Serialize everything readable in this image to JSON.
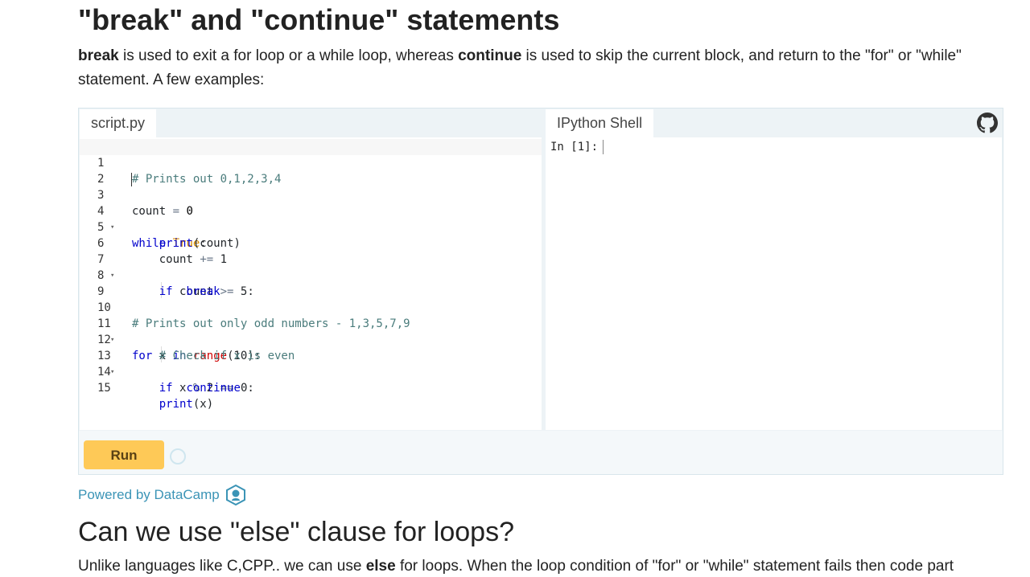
{
  "section1": {
    "title": "\"break\" and \"continue\" statements",
    "intro": {
      "kw1": "break",
      "t1": " is used to exit a for loop or a while loop, whereas ",
      "kw2": "continue",
      "t2": " is used to skip the current block, and return to the \"for\" or \"while\" statement. A few examples:"
    }
  },
  "widget": {
    "script_tab": "script.py",
    "shell_tab": "IPython Shell",
    "shell_prompt": "In [1]:",
    "run_label": "Run",
    "powered_by": "Powered by DataCamp",
    "colors": {
      "run_button": "#fec957",
      "keyword": "#0000cc",
      "builtin": "#cc0000",
      "comment": "#4a7c7c",
      "link": "#3b94b6"
    },
    "icons": {
      "github": "github-icon",
      "datacamp": "datacamp-logo-icon"
    }
  },
  "code": {
    "line_numbers": [
      "1",
      "2",
      "3",
      "4",
      "5",
      "6",
      "7",
      "8",
      "9",
      "10",
      "11",
      "12",
      "13",
      "14",
      "15"
    ],
    "l1": "# Prints out 0,1,2,3,4",
    "l3_a": "count",
    "l3_op": "=",
    "l3_b": "0",
    "l4_kw": "while",
    "l4_val": "True",
    "l4_end": ":",
    "l5_fn": "print",
    "l5_arg": "(count)",
    "l6_a": "count",
    "l6_op": "+=",
    "l6_b": "1",
    "l7_kw": "if",
    "l7_a": "count",
    "l7_op": ">=",
    "l7_b": "5:",
    "l8_kw": "break",
    "l10": "# Prints out only odd numbers - 1,3,5,7,9",
    "l11_kw": "for",
    "l11_x": "x",
    "l11_in": "in",
    "l11_fn": "range",
    "l11_arg": "(10):",
    "l12": "# Check if x is even",
    "l13_kw": "if",
    "l13_x": "x",
    "l13_op": "%",
    "l13_n": "2",
    "l13_eq": "==",
    "l13_end": "0:",
    "l14_kw": "continue",
    "l15_fn": "print",
    "l15_arg": "(x)"
  },
  "section2": {
    "title": "Can we use \"else\" clause for loops?",
    "t1": "Unlike languages like C,CPP.. we can use ",
    "kw": "else",
    "t2": " for loops. When the loop condition of \"for\" or \"while\" statement fails then code part"
  }
}
